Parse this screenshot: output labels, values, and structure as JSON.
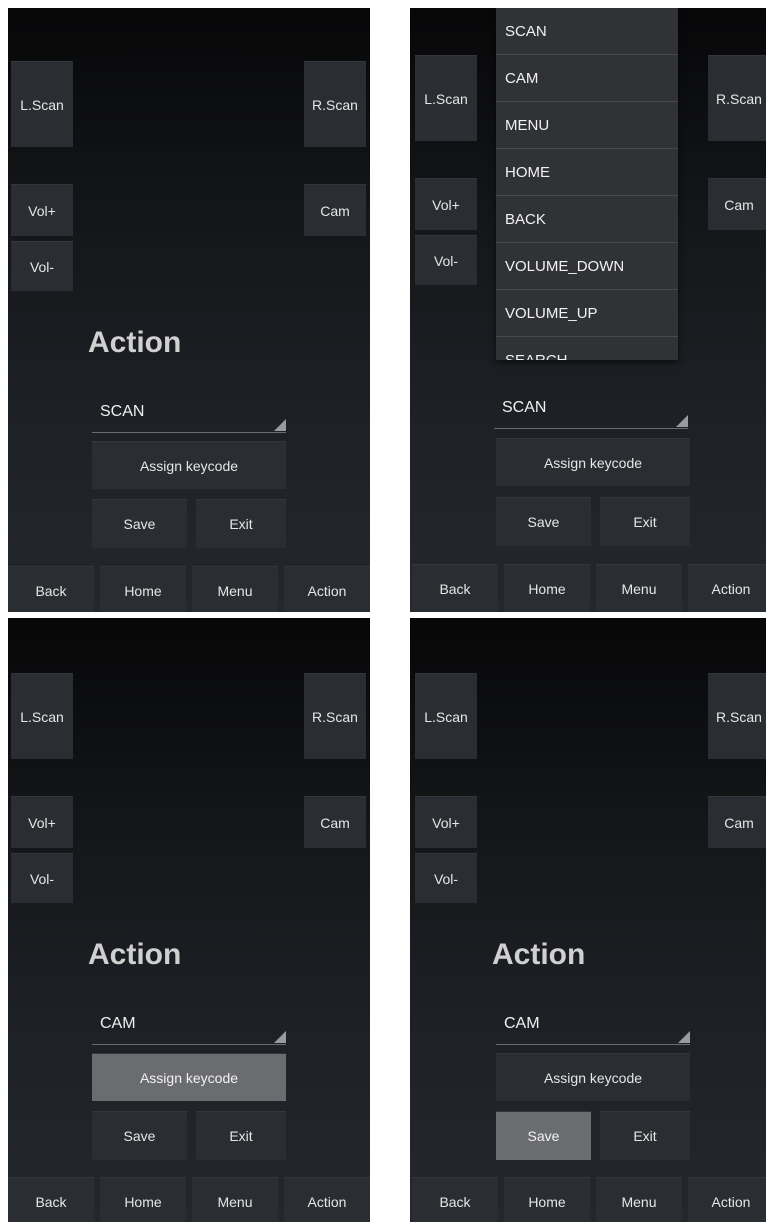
{
  "panels": [
    {
      "selected": "SCAN"
    },
    {
      "selected": "SCAN"
    },
    {
      "selected": "CAM"
    },
    {
      "selected": "CAM"
    }
  ],
  "buttons": {
    "lscan": "L.Scan",
    "rscan": "R.Scan",
    "volup": "Vol+",
    "voldown": "Vol-",
    "cam": "Cam",
    "assign": "Assign keycode",
    "save": "Save",
    "exit": "Exit"
  },
  "title": "Action",
  "nav": {
    "back": "Back",
    "home": "Home",
    "menu": "Menu",
    "action": "Action"
  },
  "dropdown": {
    "items": [
      "SCAN",
      "CAM",
      "MENU",
      "HOME",
      "BACK",
      "VOLUME_DOWN",
      "VOLUME_UP",
      "SEARCH"
    ]
  },
  "state": {
    "panel2": "dropdown-open",
    "panel3": "assign-keycode-pressed",
    "panel4": "save-pressed"
  }
}
